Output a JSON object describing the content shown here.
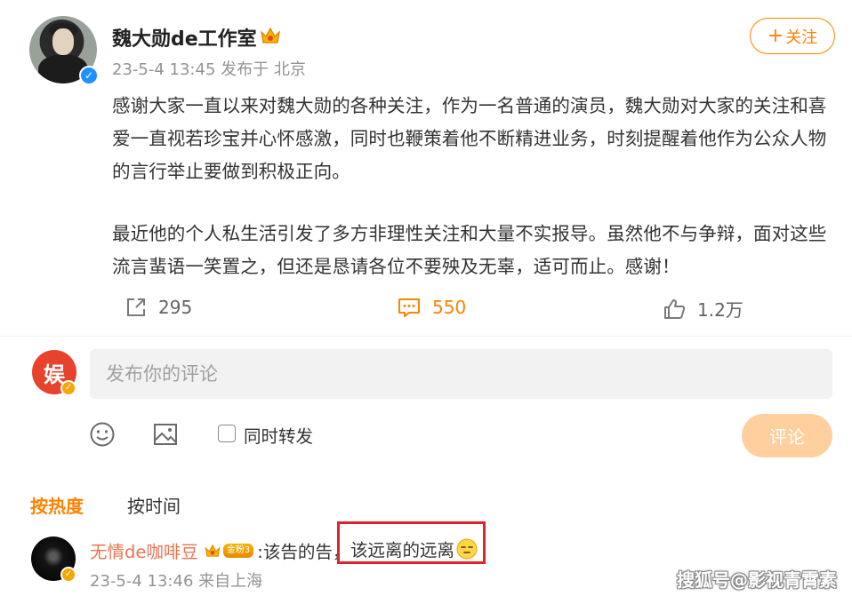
{
  "post": {
    "username": "魏大勋de工作室",
    "meta": "23-5-4 13:45 发布于 北京",
    "follow_label": "关注",
    "follow_plus": "+",
    "paragraph1": "感谢大家一直以来对魏大勋的各种关注，作为一名普通的演员，魏大勋对大家的关注和喜爱一直视若珍宝并心怀感激，同时也鞭策着他不断精进业务，时刻提醒着他作为公众人物的言行举止要做到积极正向。",
    "paragraph2": "最近他的个人私生活引发了多方非理性关注和大量不实报导。虽然他不与争辩，面对这些流言蜚语一笑置之，但还是恳请各位不要殃及无辜，适可而止。感谢！",
    "repost_count": "295",
    "comment_count": "550",
    "like_count": "1.2万"
  },
  "composer": {
    "placeholder": "发布你的评论",
    "repost_checkbox_label": "同时转发",
    "submit_label": "评论",
    "avatar_text": "娱"
  },
  "sort": {
    "hot_label": "按热度",
    "time_label": "按时间"
  },
  "comments": [
    {
      "author": "无情de咖啡豆",
      "badge": "金粉3",
      "prefix": ":该告的告，",
      "quote": "该远离的远离",
      "meta": "23-5-4 13:46 来自上海"
    }
  ],
  "watermark": "搜狐号@影视青霄素",
  "colors": {
    "accent": "#ff8200",
    "author_link": "#eb7350",
    "highlight_box": "#e0232a",
    "submit_disabled": "#ffcf9e"
  }
}
